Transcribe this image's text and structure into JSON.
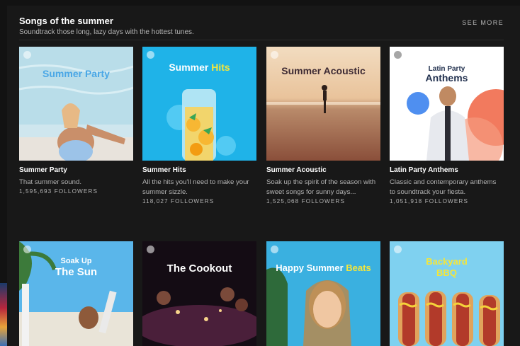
{
  "section": {
    "title": "Songs of the summer",
    "subtitle": "Soundtrack those long, lazy days with the hottest tunes.",
    "see_more": "SEE MORE"
  },
  "playlists": [
    {
      "name": "Summer Party",
      "description": "That summer sound.",
      "followers": "1,595,693 FOLLOWERS",
      "cover_text": "Summer Party"
    },
    {
      "name": "Summer Hits",
      "description": "All the hits you'll need to make your summer sizzle.",
      "followers": "118,027 FOLLOWERS",
      "cover_text_a": "Summer",
      "cover_text_b": "Hits"
    },
    {
      "name": "Summer Acoustic",
      "description": "Soak up the spirit of the season with sweet songs for sunny days...",
      "followers": "1,525,068 FOLLOWERS",
      "cover_text": "Summer Acoustic"
    },
    {
      "name": "Latin Party Anthems",
      "description": "Classic and contemporary anthems to soundtrack your fiesta.",
      "followers": "1,051,918 FOLLOWERS",
      "cover_text_a": "Latin Party",
      "cover_text_b": "Anthems"
    },
    {
      "cover_text_a": "Soak Up",
      "cover_text_b": "The Sun"
    },
    {
      "cover_text": "The Cookout"
    },
    {
      "cover_text_a": "Happy Summer",
      "cover_text_b": "Beats"
    },
    {
      "cover_text_a": "Backyard",
      "cover_text_b": "BBQ"
    }
  ],
  "colors": {
    "background": "#181818",
    "text": "#ffffff",
    "muted": "#b3b3b3",
    "hits_yellow": "#f5e63a"
  }
}
